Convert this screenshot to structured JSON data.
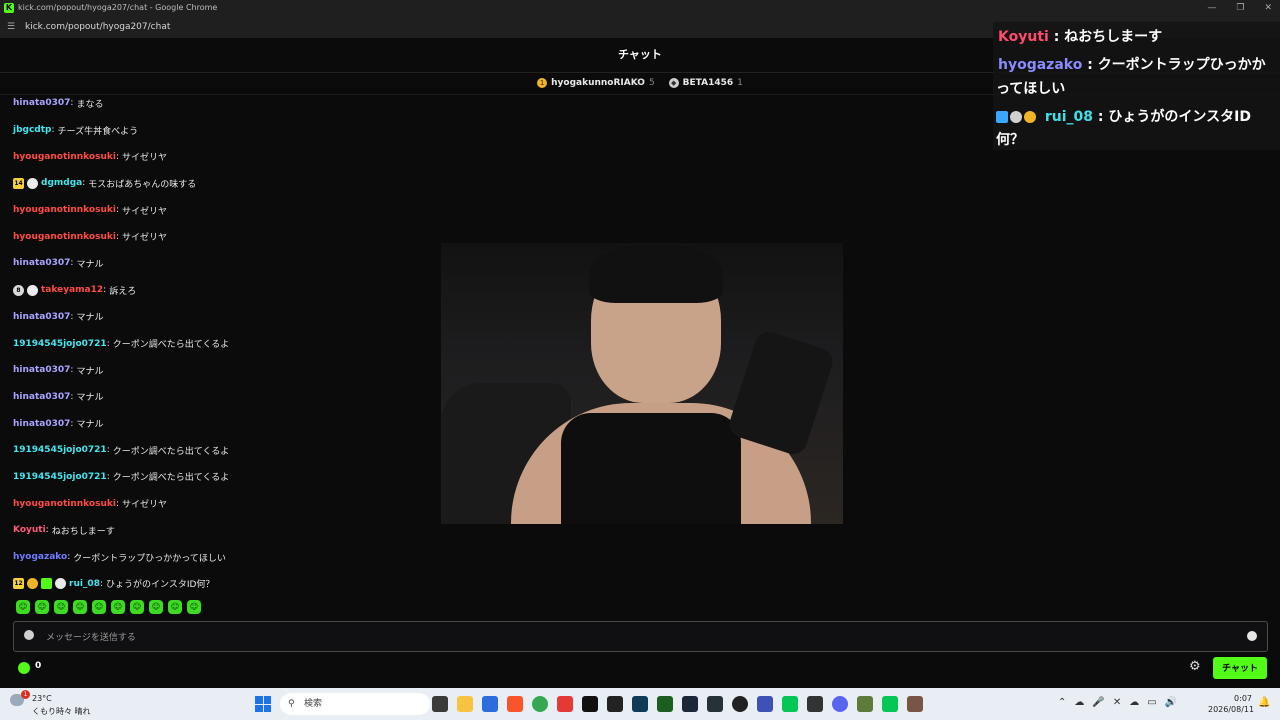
{
  "window": {
    "title": "kick.com/popout/hyoga207/chat - Google Chrome",
    "url": "kick.com/popout/hyoga207/chat"
  },
  "chat": {
    "header_title": "チャット",
    "leaderboard": [
      {
        "name": "hyogakunnoRIAKO",
        "count": "5"
      },
      {
        "name": "BETA1456",
        "count": "1"
      }
    ],
    "messages": [
      {
        "user": "hinata0307",
        "color": "u-lav",
        "text": "まなる",
        "badges": []
      },
      {
        "user": "jbgcdtp",
        "color": "u-cyan",
        "text": "チーズ牛丼食べよう",
        "badges": []
      },
      {
        "user": "hyouganotinnkosuki",
        "color": "u-red",
        "text": "サイゼリヤ",
        "badges": []
      },
      {
        "user": "dgmdga",
        "color": "u-cyan",
        "text": "モスおばあちゃんの味する",
        "badges": [
          "14",
          "gray"
        ]
      },
      {
        "user": "hyouganotinnkosuki",
        "color": "u-red",
        "text": "サイゼリヤ",
        "badges": []
      },
      {
        "user": "hyouganotinnkosuki",
        "color": "u-red",
        "text": "サイゼリヤ",
        "badges": []
      },
      {
        "user": "hinata0307",
        "color": "u-lav",
        "text": "マナル",
        "badges": []
      },
      {
        "user": "takeyama12",
        "color": "u-red",
        "text": "訴えろ",
        "badges": [
          "8",
          "gray"
        ]
      },
      {
        "user": "hinata0307",
        "color": "u-lav",
        "text": "マナル",
        "badges": []
      },
      {
        "user": "19194545jojo0721",
        "color": "u-cyan",
        "text": "クーポン調べたら出てくるよ",
        "badges": []
      },
      {
        "user": "hinata0307",
        "color": "u-lav",
        "text": "マナル",
        "badges": []
      },
      {
        "user": "hinata0307",
        "color": "u-lav",
        "text": "マナル",
        "badges": []
      },
      {
        "user": "hinata0307",
        "color": "u-lav",
        "text": "マナル",
        "badges": []
      },
      {
        "user": "19194545jojo0721",
        "color": "u-cyan",
        "text": "クーポン調べたら出てくるよ",
        "badges": []
      },
      {
        "user": "19194545jojo0721",
        "color": "u-cyan",
        "text": "クーポン調べたら出てくるよ",
        "badges": []
      },
      {
        "user": "hyouganotinnkosuki",
        "color": "u-red",
        "text": "サイゼリヤ",
        "badges": []
      },
      {
        "user": "Koyuti",
        "color": "u-pink",
        "text": "ねおちしまーす",
        "badges": []
      },
      {
        "user": "hyogazako",
        "color": "u-blue",
        "text": "クーポントラップひっかかってほしい",
        "badges": []
      },
      {
        "user": "rui_08",
        "color": "u-cyan",
        "text": "ひょうがのインスタID何？",
        "badges": [
          "12",
          "coin",
          "green",
          "gray"
        ]
      }
    ],
    "input_placeholder": "メッセージを送信する",
    "kick_coins": "0",
    "send_label": "チャット"
  },
  "overlay": {
    "messages": [
      {
        "user": "Koyuti",
        "text": "ねおちしまーす"
      },
      {
        "user": "hyogazako",
        "text_line1": "クーポントラップひっかか",
        "text_line2": "ってほしい"
      },
      {
        "user": "rui_08",
        "text_line1": "ひょうがのインスタID",
        "text_line2": "何？"
      }
    ]
  },
  "taskbar": {
    "temperature": "23°C",
    "weather": "くもり時々 晴れ",
    "weather_badge": "1",
    "search_label": "検索",
    "time": "0:07",
    "date": "2026/08/11"
  },
  "colors": {
    "kick_green": "#53fc18",
    "background": "#0b0b0c"
  }
}
